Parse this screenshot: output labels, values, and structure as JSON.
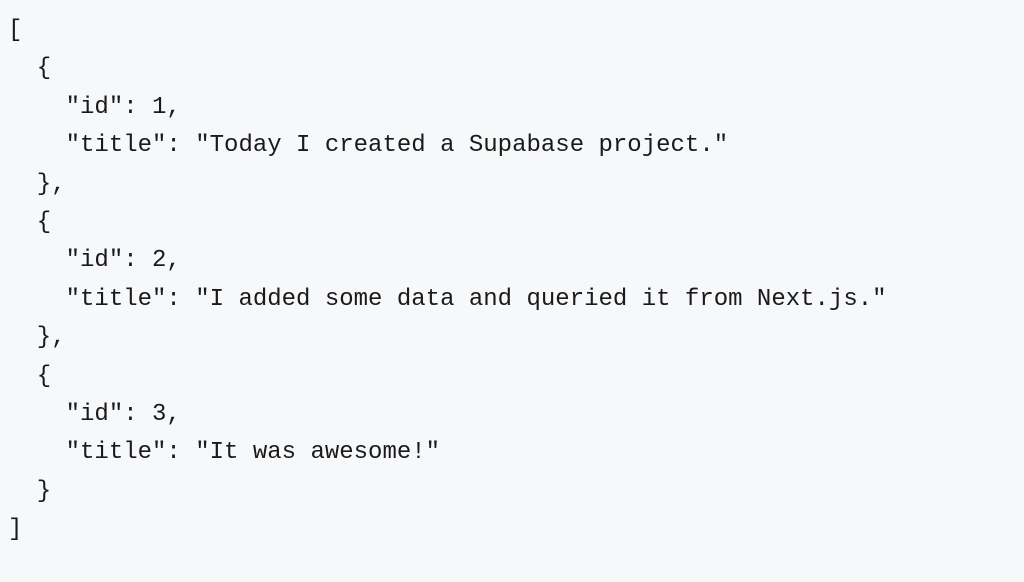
{
  "code": {
    "lines": [
      "[",
      "  {",
      "    \"id\": 1,",
      "    \"title\": \"Today I created a Supabase project.\"",
      "  },",
      "  {",
      "    \"id\": 2,",
      "    \"title\": \"I added some data and queried it from Next.js.\"",
      "  },",
      "  {",
      "    \"id\": 3,",
      "    \"title\": \"It was awesome!\"",
      "  }",
      "]"
    ]
  }
}
